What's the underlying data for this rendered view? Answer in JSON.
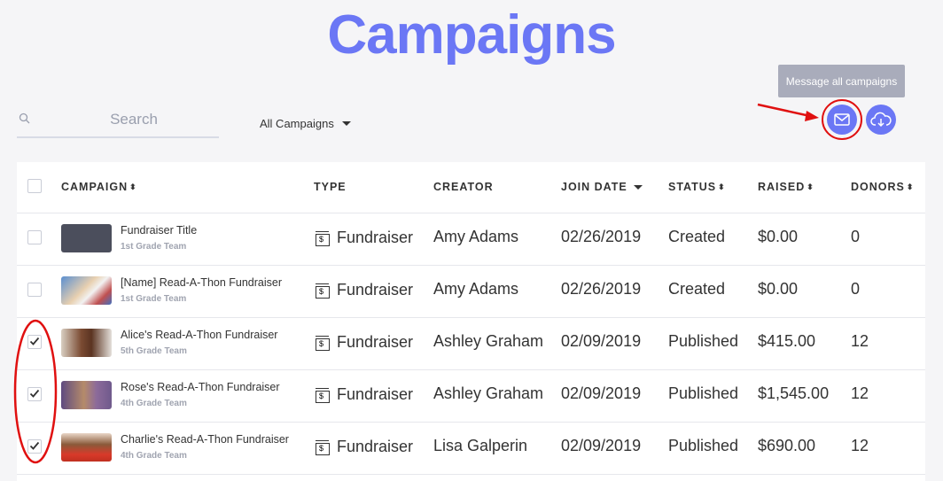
{
  "page": {
    "title": "Campaigns"
  },
  "search": {
    "placeholder": "Search"
  },
  "filter": {
    "label": "All Campaigns"
  },
  "actions": {
    "message_tooltip": "Message all campaigns"
  },
  "table": {
    "headers": {
      "campaign": "CAMPAIGN",
      "type": "TYPE",
      "creator": "CREATOR",
      "join_date": "JOIN DATE",
      "status": "STATUS",
      "raised": "RAISED",
      "donors": "DONORS"
    },
    "rows": [
      {
        "name": "Fundraiser Title",
        "team": "1st Grade Team",
        "type": "Fundraiser",
        "creator": "Amy Adams",
        "date": "02/26/2019",
        "status": "Created",
        "raised": "$0.00",
        "donors": "0",
        "checked": false
      },
      {
        "name": "[Name] Read-A-Thon Fundraiser",
        "team": "1st Grade Team",
        "type": "Fundraiser",
        "creator": "Amy Adams",
        "date": "02/26/2019",
        "status": "Created",
        "raised": "$0.00",
        "donors": "0",
        "checked": false
      },
      {
        "name": "Alice's Read-A-Thon Fundraiser",
        "team": "5th Grade Team",
        "type": "Fundraiser",
        "creator": "Ashley Graham",
        "date": "02/09/2019",
        "status": "Published",
        "raised": "$415.00",
        "donors": "12",
        "checked": true
      },
      {
        "name": "Rose's Read-A-Thon Fundraiser",
        "team": "4th Grade Team",
        "type": "Fundraiser",
        "creator": "Ashley Graham",
        "date": "02/09/2019",
        "status": "Published",
        "raised": "$1,545.00",
        "donors": "12",
        "checked": true
      },
      {
        "name": "Charlie's Read-A-Thon Fundraiser",
        "team": "4th Grade Team",
        "type": "Fundraiser",
        "creator": "Lisa Galperin",
        "date": "02/09/2019",
        "status": "Published",
        "raised": "$690.00",
        "donors": "12",
        "checked": true
      }
    ]
  },
  "colors": {
    "brand": "#6b77f5",
    "annotation": "#e01010",
    "text": "#333333",
    "muted": "#a0a4b0"
  }
}
